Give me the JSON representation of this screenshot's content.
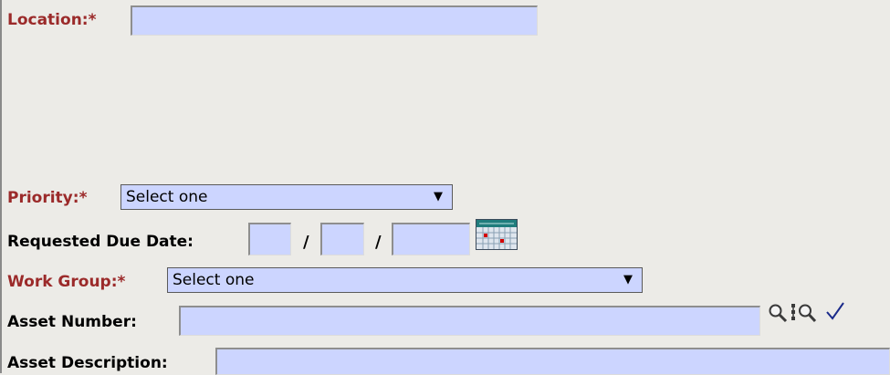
{
  "form": {
    "location": {
      "label": "Location:",
      "required_mark": "*",
      "value": ""
    },
    "priority": {
      "label": "Priority:",
      "required_mark": "*",
      "selected": "Select one"
    },
    "requested_due_date": {
      "label": "Requested Due Date:",
      "separator": "/",
      "month": "",
      "day": "",
      "year": ""
    },
    "work_group": {
      "label": "Work Group:",
      "required_mark": "*",
      "selected": "Select one"
    },
    "asset_number": {
      "label": "Asset Number:",
      "value": ""
    },
    "asset_description": {
      "label": "Asset Description:",
      "value": ""
    }
  },
  "icons": {
    "date_picker": "calendar-icon",
    "asset_search": "magnifier-icon",
    "asset_tree_search": "tree-search-icon",
    "validate": "checkmark-icon"
  },
  "colors": {
    "background": "#ecebe7",
    "field_fill": "#ccd5ff",
    "required_label": "#9b2a2a",
    "icon_blue": "#1a2a8a"
  }
}
